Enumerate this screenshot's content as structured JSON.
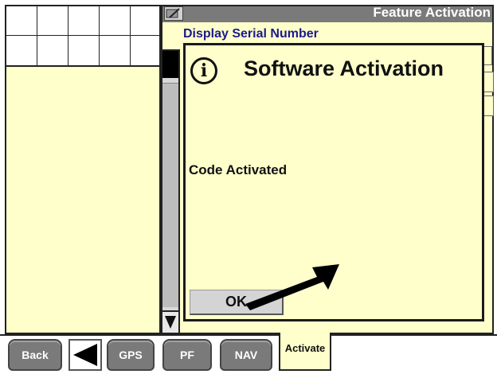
{
  "header": {
    "title": "Feature Activation",
    "icon": "edit-display-icon"
  },
  "feature": {
    "serial_label": "Display Serial Number"
  },
  "dialog": {
    "title": "Software Activation",
    "icon": "info-icon",
    "message": "Code Activated",
    "ok_label": "OK"
  },
  "scroll": {
    "down_icon": "arrow-down-icon"
  },
  "bottom_nav": {
    "back_label": "Back",
    "arrow_icon": "left-arrow-icon",
    "gps_label": "GPS",
    "pf_label": "PF",
    "nav_label": "NAV",
    "activate_label": "Activate"
  },
  "colors": {
    "panel_bg": "#ffffcc",
    "header_bg": "#7a7a7a",
    "button_bg": "#7a7a7a",
    "serial_label": "#1a1a8c"
  }
}
